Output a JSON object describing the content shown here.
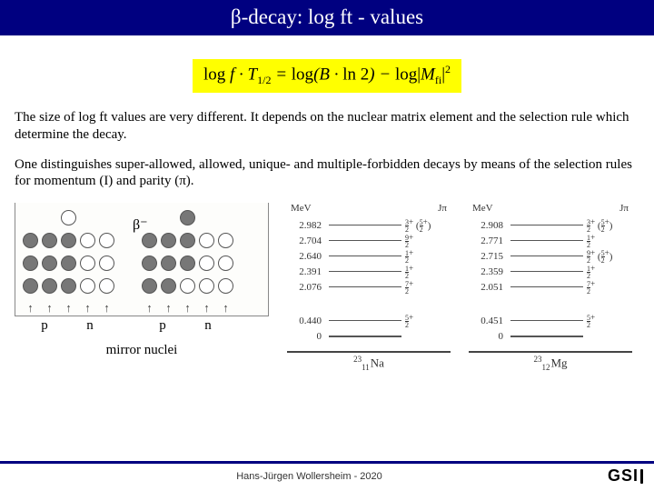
{
  "title": "β-decay: log ft - values",
  "equation_parts": {
    "lhs_log": "log",
    "lhs_f": " f",
    "lhs_dot": " · ",
    "lhs_T": "T",
    "lhs_Tsub": "1/2",
    "eq": " = ",
    "rhs1_log": "log",
    "rhs1_open": "(B · ",
    "rhs1_ln2": "ln 2",
    "rhs1_close": ") − ",
    "rhs2_log": "log",
    "rhs2_bar1": "|",
    "rhs2_M": "M",
    "rhs2_Msub": "fi",
    "rhs2_bar2": "|",
    "rhs2_sq": "2"
  },
  "paragraphs": {
    "p1": "The size of log ft values are very different. It depends on the nuclear matrix element and the selection rule which determine the decay.",
    "p2": "One distinguishes super-allowed, allowed, unique- and multiple-forbidden decays by means of the selection rules for momentum (I) and parity (π)."
  },
  "shell": {
    "beta_label": "β⁻",
    "p_label": "p",
    "n_label": "n",
    "mirror_caption": "mirror nuclei"
  },
  "levels": {
    "col_headers": {
      "left": "MeV",
      "right": "Jπ"
    },
    "na": {
      "items": [
        {
          "e": "2.982",
          "num": "3",
          "den": "2",
          "par": "+",
          "extra_num": "5",
          "extra_den": "2",
          "extra_par": "+"
        },
        {
          "e": "2.704",
          "num": "9",
          "den": "2",
          "par": "+"
        },
        {
          "e": "2.640",
          "num": "1",
          "den": "2",
          "par": "+"
        },
        {
          "e": "2.391",
          "num": "1",
          "den": "2",
          "par": "+"
        },
        {
          "e": "2.076",
          "num": "7",
          "den": "2",
          "par": "+"
        }
      ],
      "ground": {
        "e": "0.440",
        "num": "5",
        "den": "2",
        "par": "+"
      },
      "zero": "0",
      "A": "23",
      "Z": "11",
      "sym": "Na"
    },
    "mg": {
      "items": [
        {
          "e": "2.908",
          "num": "3",
          "den": "2",
          "par": "+",
          "extra_num": "5",
          "extra_den": "2",
          "extra_par": "+"
        },
        {
          "e": "2.771",
          "num": "1",
          "den": "2",
          "par": "+"
        },
        {
          "e": "2.715",
          "num": "9",
          "den": "2",
          "par": "+",
          "extra_num": "5",
          "extra_den": "2",
          "extra_par": "+"
        },
        {
          "e": "2.359",
          "num": "1",
          "den": "2",
          "par": "+"
        },
        {
          "e": "2.051",
          "num": "7",
          "den": "2",
          "par": "+"
        }
      ],
      "ground": {
        "e": "0.451",
        "num": "5",
        "den": "2",
        "par": "+"
      },
      "zero": "0",
      "A": "23",
      "Z": "12",
      "sym": "Mg"
    }
  },
  "footer": {
    "author": "Hans-Jürgen Wollersheim - 2020",
    "logo_text": "GSI"
  }
}
